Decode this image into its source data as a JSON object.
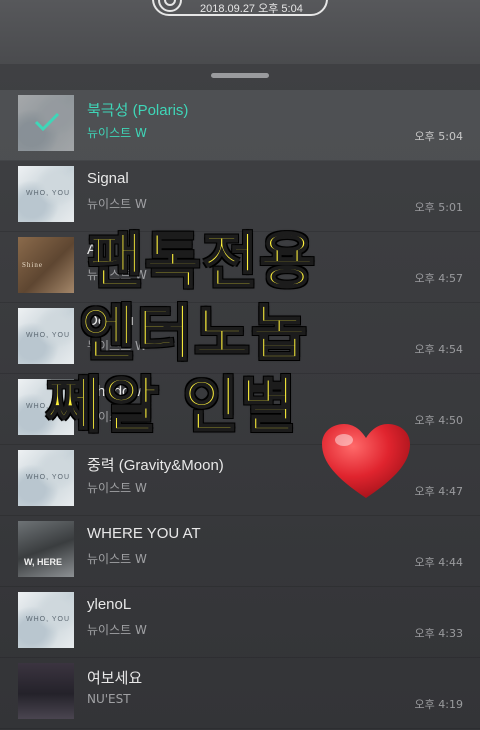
{
  "status_pill": {
    "date_text": "2018.09.27 오후 5:04"
  },
  "songs": [
    {
      "title": "북극성 (Polaris)",
      "artist": "뉴이스트 W",
      "time": "오후 5:04",
      "art_label": "",
      "selected": true
    },
    {
      "title": "Signal",
      "artist": "뉴이스트 W",
      "time": "오후 5:01",
      "art_label": "WHO, YOU"
    },
    {
      "title": "A",
      "artist": "뉴이스트 W",
      "time": "오후 4:57",
      "art_label": "Shine"
    },
    {
      "title": "Dejavu",
      "artist": "뉴이스트 W",
      "time": "오후 4:54",
      "art_label": "WHO, YOU"
    },
    {
      "title": "Shadow",
      "artist": "뉴이스트 W",
      "time": "오후 4:50",
      "art_label": "WHO, YOU"
    },
    {
      "title": "중력 (Gravity&Moon)",
      "artist": "뉴이스트 W",
      "time": "오후 4:47",
      "art_label": "WHO, YOU"
    },
    {
      "title": "WHERE YOU AT",
      "artist": "뉴이스트 W",
      "time": "오후 4:44",
      "art_label": "W, HERE"
    },
    {
      "title": "ylenoL",
      "artist": "뉴이스트 W",
      "time": "오후 4:33",
      "art_label": "WHO, YOU"
    },
    {
      "title": "여보세요",
      "artist": "NU'EST",
      "time": "오후 4:19",
      "art_label": ""
    }
  ],
  "overlay": {
    "line1": "팬톡전용",
    "line2": "엔터노놉",
    "line3": "쩨알 인별",
    "heart_color": "#e0242e",
    "text_color": "#fff23a"
  },
  "colors": {
    "accent": "#3fd6b8",
    "background": "#2c2d30"
  }
}
